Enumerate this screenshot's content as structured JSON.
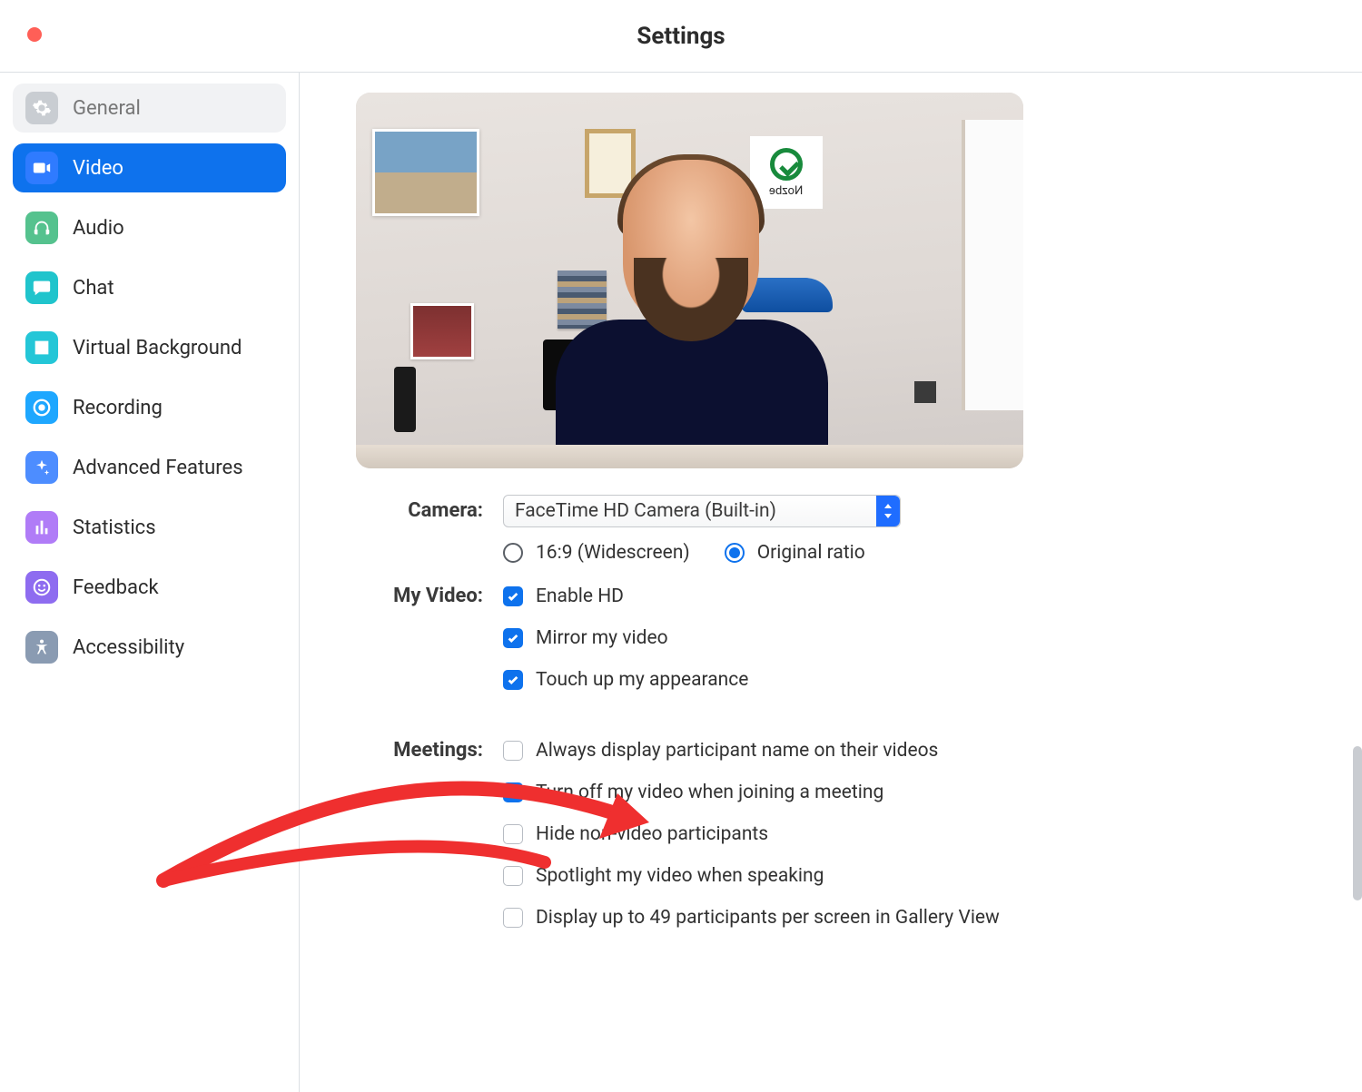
{
  "window": {
    "title": "Settings"
  },
  "sidebar": {
    "items": [
      {
        "id": "general",
        "label": "General"
      },
      {
        "id": "video",
        "label": "Video"
      },
      {
        "id": "audio",
        "label": "Audio"
      },
      {
        "id": "chat",
        "label": "Chat"
      },
      {
        "id": "virtual-bg",
        "label": "Virtual Background"
      },
      {
        "id": "recording",
        "label": "Recording"
      },
      {
        "id": "advanced",
        "label": "Advanced Features"
      },
      {
        "id": "statistics",
        "label": "Statistics"
      },
      {
        "id": "feedback",
        "label": "Feedback"
      },
      {
        "id": "accessibility",
        "label": "Accessibility"
      }
    ],
    "selected": "video"
  },
  "video": {
    "camera_label": "Camera:",
    "camera_selected": "FaceTime HD Camera (Built-in)",
    "ratio": {
      "widescreen": "16:9 (Widescreen)",
      "original": "Original ratio",
      "selected": "original"
    },
    "my_video_label": "My Video:",
    "my_video": {
      "enable_hd": {
        "label": "Enable HD",
        "checked": true
      },
      "mirror": {
        "label": "Mirror my video",
        "checked": true
      },
      "touch_up": {
        "label": "Touch up my appearance",
        "checked": true
      }
    },
    "meetings_label": "Meetings:",
    "meetings": {
      "display_name": {
        "label": "Always display participant name on their videos",
        "checked": false
      },
      "turn_off_join": {
        "label": "Turn off my video when joining a meeting",
        "checked": true
      },
      "hide_nonvideo": {
        "label": "Hide non-video participants",
        "checked": false
      },
      "spotlight": {
        "label": "Spotlight my video when speaking",
        "checked": false
      },
      "gallery49": {
        "label": "Display up to 49 participants per screen in Gallery View",
        "checked": false
      }
    }
  },
  "preview": {
    "logo_text": "Nozbe"
  },
  "colors": {
    "accent": "#0e72ed",
    "annotation": "#ef2f2f"
  }
}
